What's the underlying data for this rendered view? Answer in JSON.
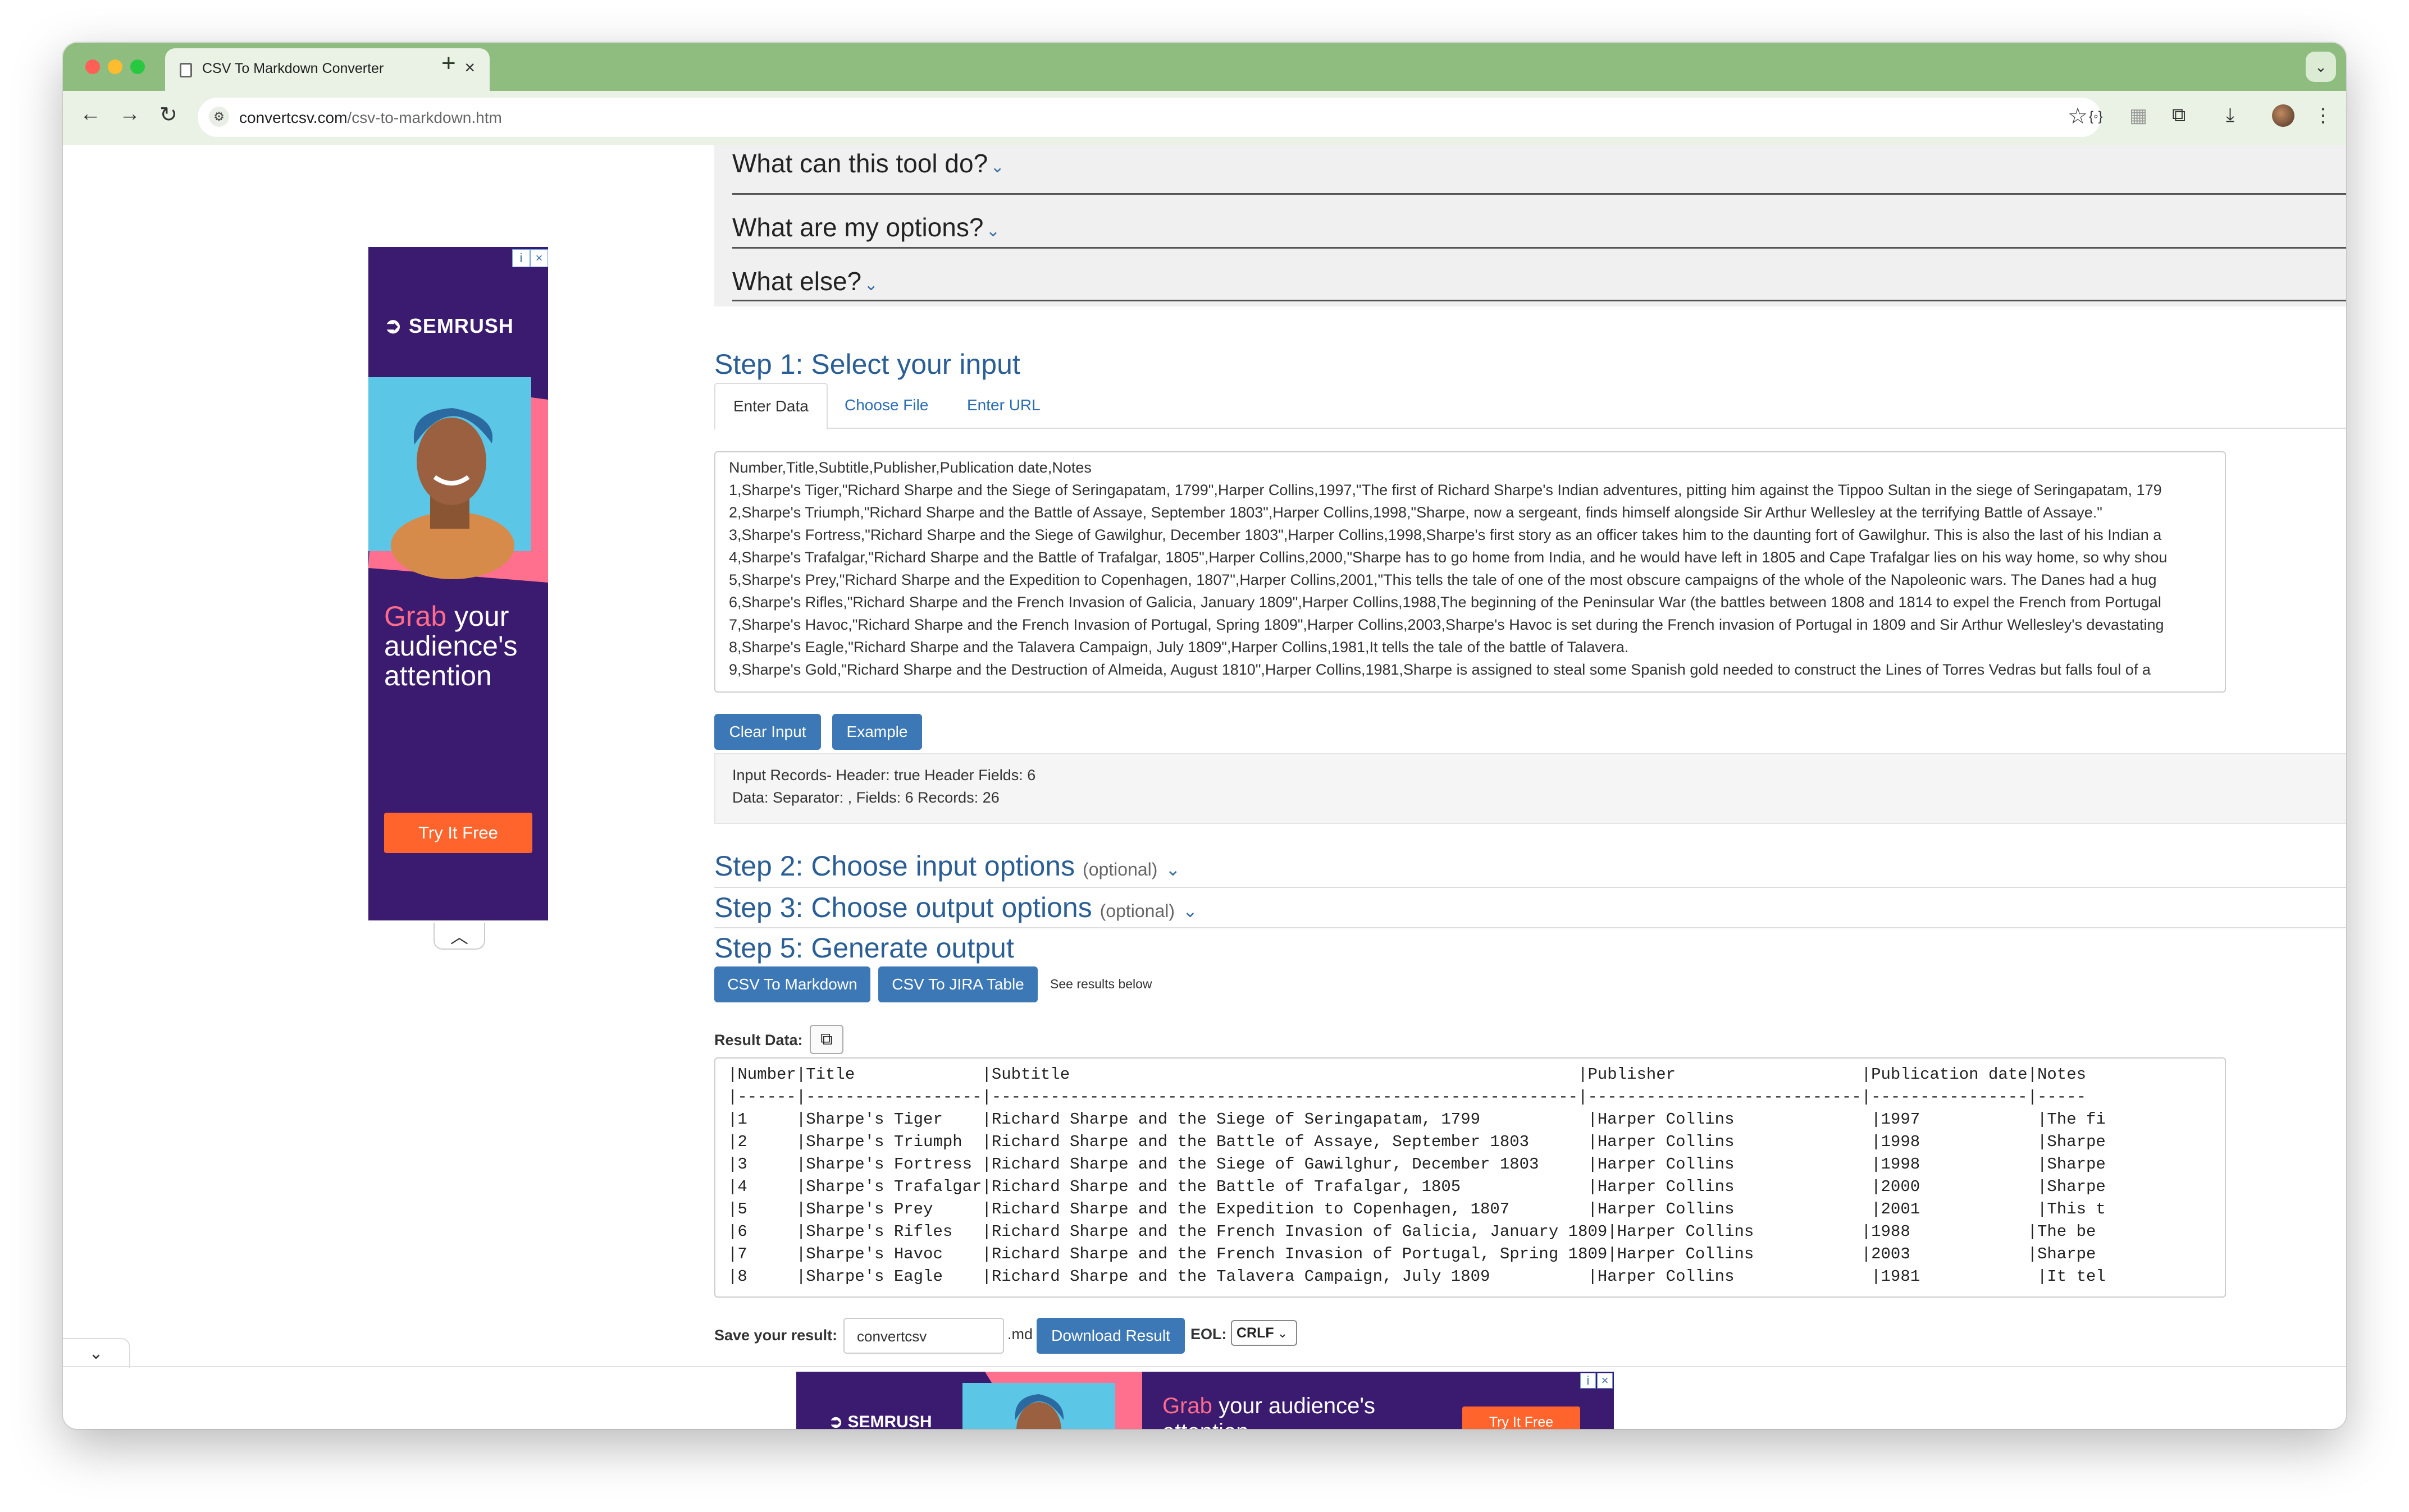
{
  "browser": {
    "tab_title": "CSV To Markdown Converter",
    "url_host": "convertcsv.com",
    "url_path": "/csv-to-markdown.htm"
  },
  "faq": [
    {
      "label": "What can this tool do?"
    },
    {
      "label": "What are my options?"
    },
    {
      "label": "What else?"
    }
  ],
  "step1": {
    "heading": "Step 1: Select your input",
    "tabs": [
      "Enter Data",
      "Choose File",
      "Enter URL"
    ],
    "input_lines": [
      "Number,Title,Subtitle,Publisher,Publication date,Notes",
      "1,Sharpe's Tiger,\"Richard Sharpe and the Siege of Seringapatam, 1799\",Harper Collins,1997,\"The first of Richard Sharpe's Indian adventures, pitting him against the Tippoo Sultan in the siege of Seringapatam, 179",
      "2,Sharpe's Triumph,\"Richard Sharpe and the Battle of Assaye, September 1803\",Harper Collins,1998,\"Sharpe, now a sergeant, finds himself alongside Sir Arthur Wellesley at the terrifying Battle of Assaye.\"",
      "3,Sharpe's Fortress,\"Richard Sharpe and the Siege of Gawilghur, December 1803\",Harper Collins,1998,Sharpe's first story as an officer takes him to the daunting fort of Gawilghur. This is also the last of his Indian a",
      "4,Sharpe's Trafalgar,\"Richard Sharpe and the Battle of Trafalgar, 1805\",Harper Collins,2000,\"Sharpe has to go home from India, and he would have left in 1805 and Cape Trafalgar lies on his way home, so why shou",
      "5,Sharpe's Prey,\"Richard Sharpe and the Expedition to Copenhagen, 1807\",Harper Collins,2001,\"This tells the tale of one of the most obscure campaigns of the whole of the Napoleonic wars. The Danes had a hug",
      "6,Sharpe's Rifles,\"Richard Sharpe and the French Invasion of Galicia, January 1809\",Harper Collins,1988,The beginning of the Peninsular War (the battles between 1808 and 1814 to expel the French from Portugal",
      "7,Sharpe's Havoc,\"Richard Sharpe and the French Invasion of Portugal, Spring 1809\",Harper Collins,2003,Sharpe's Havoc is set during the French invasion of Portugal in 1809 and Sir Arthur Wellesley's devastating",
      "8,Sharpe's Eagle,\"Richard Sharpe and the Talavera Campaign, July 1809\",Harper Collins,1981,It tells the tale of the battle of Talavera.",
      "9,Sharpe's Gold,\"Richard Sharpe and the Destruction of Almeida, August 1810\",Harper Collins,1981,Sharpe is assigned to steal some Spanish gold needed to construct the Lines of Torres Vedras but falls foul of a"
    ],
    "clear_button": "Clear Input",
    "example_button": "Example",
    "stats_line1": "Input Records- Header: true   Header Fields: 6",
    "stats_line2": "Data: Separator: ,     Fields: 6     Records: 26"
  },
  "step2": {
    "heading": "Step 2: Choose input options",
    "optional": "(optional)"
  },
  "step3": {
    "heading": "Step 3: Choose output options",
    "optional": "(optional)"
  },
  "step5": {
    "heading": "Step 5: Generate output",
    "markdown_button": "CSV To Markdown",
    "jira_button": "CSV To JIRA Table",
    "see_results": "See results below"
  },
  "result": {
    "label": "Result Data:",
    "lines": [
      "|Number|Title             |Subtitle                                                    |Publisher                   |Publication date|Notes",
      "|------|------------------|------------------------------------------------------------|----------------------------|----------------|-----",
      "|1     |Sharpe's Tiger    |Richard Sharpe and the Siege of Seringapatam, 1799           |Harper Collins              |1997            |The fi",
      "|2     |Sharpe's Triumph  |Richard Sharpe and the Battle of Assaye, September 1803      |Harper Collins              |1998            |Sharpe",
      "|3     |Sharpe's Fortress |Richard Sharpe and the Siege of Gawilghur, December 1803     |Harper Collins              |1998            |Sharpe",
      "|4     |Sharpe's Trafalgar|Richard Sharpe and the Battle of Trafalgar, 1805             |Harper Collins              |2000            |Sharpe",
      "|5     |Sharpe's Prey     |Richard Sharpe and the Expedition to Copenhagen, 1807        |Harper Collins              |2001            |This t",
      "|6     |Sharpe's Rifles   |Richard Sharpe and the French Invasion of Galicia, January 1809|Harper Collins           |1988            |The be",
      "|7     |Sharpe's Havoc    |Richard Sharpe and the French Invasion of Portugal, Spring 1809|Harper Collins           |2003            |Sharpe",
      "|8     |Sharpe's Eagle    |Richard Sharpe and the Talavera Campaign, July 1809          |Harper Collins              |1981            |It tel"
    ]
  },
  "save": {
    "label": "Save your result:",
    "filename": "convertcsv",
    "ext": ".md",
    "download_button": "Download Result",
    "eol_label": "EOL:",
    "eol_value": "CRLF"
  },
  "ads": {
    "brand": "SEMRUSH",
    "grab": "Grab",
    "headline_rest": "your audience's attention",
    "cta": "Try It Free"
  }
}
